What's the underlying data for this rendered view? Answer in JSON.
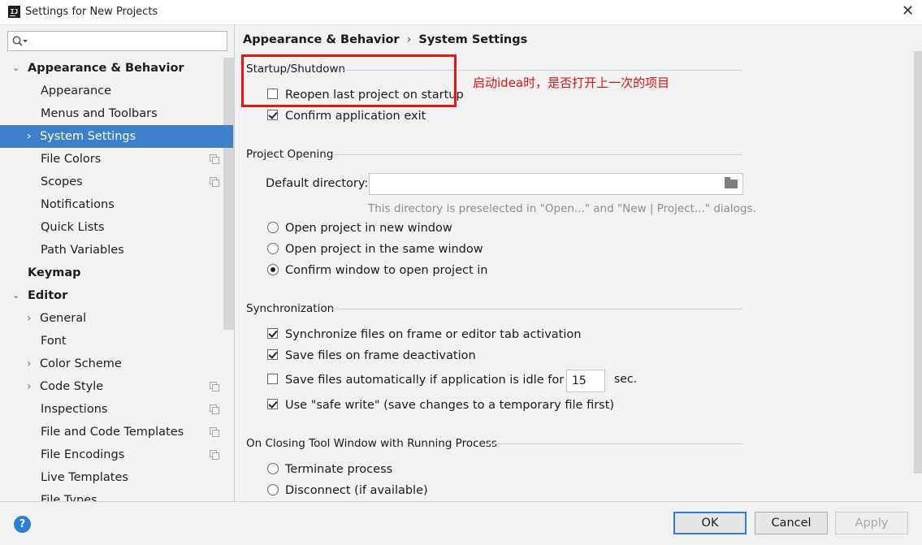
{
  "window": {
    "title": "Settings for New Projects",
    "icon_text": "IJ"
  },
  "search": {
    "value": "",
    "placeholder": ""
  },
  "sidebar": {
    "items": [
      {
        "label": "Appearance & Behavior",
        "arrow": "⌄"
      },
      {
        "label": "Appearance"
      },
      {
        "label": "Menus and Toolbars"
      },
      {
        "label": "System Settings",
        "arrow": "›"
      },
      {
        "label": "File Colors"
      },
      {
        "label": "Scopes"
      },
      {
        "label": "Notifications"
      },
      {
        "label": "Quick Lists"
      },
      {
        "label": "Path Variables"
      },
      {
        "label": "Keymap"
      },
      {
        "label": "Editor",
        "arrow": "⌄"
      },
      {
        "label": "General",
        "arrow": "›"
      },
      {
        "label": "Font"
      },
      {
        "label": "Color Scheme",
        "arrow": "›"
      },
      {
        "label": "Code Style",
        "arrow": "›"
      },
      {
        "label": "Inspections"
      },
      {
        "label": "File and Code Templates"
      },
      {
        "label": "File Encodings"
      },
      {
        "label": "Live Templates"
      },
      {
        "label": "File Types"
      }
    ]
  },
  "breadcrumb": {
    "parent": "Appearance & Behavior",
    "separator": "›",
    "current": "System Settings"
  },
  "startup": {
    "title": "Startup/Shutdown",
    "reopen_label": "Reopen last project on startup",
    "reopen_checked": false,
    "confirm_exit_label": "Confirm application exit",
    "confirm_exit_checked": true
  },
  "project_opening": {
    "title": "Project Opening",
    "default_dir_label": "Default directory:",
    "default_dir_value": "",
    "hint": "This directory is preselected in \"Open...\" and \"New | Project...\" dialogs.",
    "radio_new_window": "Open project in new window",
    "radio_same_window": "Open project in the same window",
    "radio_confirm": "Confirm window to open project in",
    "selected": "confirm"
  },
  "synchronization": {
    "title": "Synchronization",
    "sync_frame_label": "Synchronize files on frame or editor tab activation",
    "sync_frame_checked": true,
    "save_deactivation_label": "Save files on frame deactivation",
    "save_deactivation_checked": true,
    "save_idle_label": "Save files automatically if application is idle for",
    "save_idle_checked": false,
    "idle_seconds": "15",
    "idle_unit": "sec.",
    "safe_write_label": "Use \"safe write\" (save changes to a temporary file first)",
    "safe_write_checked": true
  },
  "closing": {
    "title": "On Closing Tool Window with Running Process",
    "terminate_label": "Terminate process",
    "disconnect_label": "Disconnect (if available)"
  },
  "annotation": {
    "text": "启动idea时，是否打开上一次的项目",
    "color": "#e01010"
  },
  "footer": {
    "help_label": "?",
    "ok_label": "OK",
    "cancel_label": "Cancel",
    "apply_label": "Apply"
  },
  "colors": {
    "accent": "#3d7fc8",
    "background": "#f2f2f2",
    "annotation": "#f01212"
  }
}
